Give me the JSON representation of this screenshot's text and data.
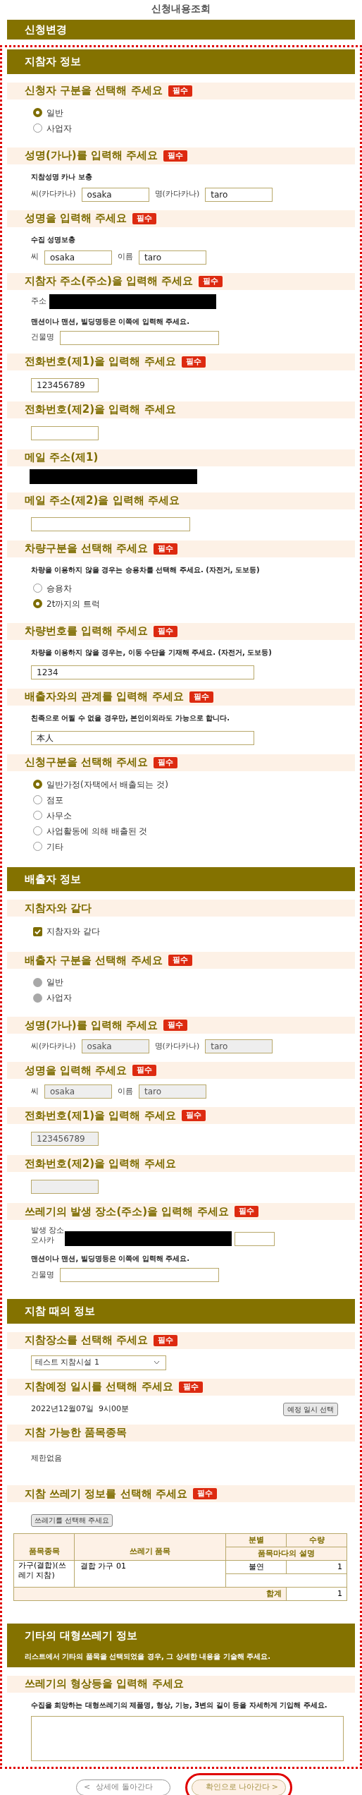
{
  "title": "신청내용조회",
  "header_bar": "신청변경",
  "sections": [
    {
      "title": "지참자 정보",
      "fields": [
        {
          "kind": "radio",
          "heading": "신청자 구분을 선택해 주세요",
          "badge": "필수",
          "disabled": false,
          "options": [
            {
              "label": "일반",
              "selected": true
            },
            {
              "label": "사업자",
              "selected": false
            }
          ]
        },
        {
          "kind": "name_pair",
          "heading": "성명(가나)를 입력해 주세요",
          "badge": "필수",
          "note": "지참성명 카나 보충",
          "disabled": false,
          "inputs": [
            {
              "label": "씨(카다카나)",
              "value": "osaka"
            },
            {
              "label": "명(카다카나)",
              "value": "taro"
            }
          ]
        },
        {
          "kind": "name_pair",
          "heading": "성명을 입력해 주세요",
          "badge": "필수",
          "note": "수집 성명보충",
          "disabled": false,
          "inputs": [
            {
              "label": "씨",
              "value": "osaka"
            },
            {
              "label": "이름",
              "value": "taro"
            }
          ]
        },
        {
          "kind": "address",
          "heading": "지참자 주소(주소)을 입력해 주세요",
          "badge": "필수",
          "label": "주소",
          "redacted": true,
          "note": "맨션이나 맨션, 빌딩명등은 이쪽에 입력해 주세요.",
          "building_label": "건물명"
        },
        {
          "kind": "phone",
          "heading": "전화번호(제1)을 입력해 주세요",
          "badge": "필수",
          "disabled": false,
          "value": "123456789"
        },
        {
          "kind": "phone",
          "heading": "전화번호(제2)을 입력해 주세요",
          "disabled": false
        },
        {
          "kind": "redacted",
          "heading": "메일 주소(제1)",
          "redacted": true
        },
        {
          "kind": "email",
          "heading": "메일 주소(제2)을 입력해 주세요",
          "disabled": false
        },
        {
          "kind": "radio",
          "heading": "차량구분을 선택해 주세요",
          "badge": "필수",
          "note": "차량을 이용하지 않을 경우는 승용차를 선택해 주세요. (자전거, 도보등)",
          "disabled": false,
          "options": [
            {
              "label": "승용차",
              "selected": false
            },
            {
              "label": "2t까지의 트럭",
              "selected": true
            }
          ]
        },
        {
          "kind": "text",
          "heading": "차량번호를 입력해 주세요",
          "badge": "필수",
          "note": "차량을 이용하지 않을 경우는, 이동 수단을 기재해 주세요. (자전거, 도보등)",
          "disabled": false,
          "value": "1234"
        },
        {
          "kind": "text",
          "heading": "배출자와의 관계를 입력해 주세요",
          "badge": "필수",
          "note": "친족으로 어찔 수 없을 경우만, 본인이외라도 가능으로 합니다.",
          "disabled": false,
          "value": "本人"
        },
        {
          "kind": "radio",
          "heading": "신청구분을 선택해 주세요",
          "badge": "필수",
          "disabled": false,
          "options": [
            {
              "label": "일반가정(자택에서 배출되는 것)",
              "selected": true
            },
            {
              "label": "점포",
              "selected": false
            },
            {
              "label": "사무소",
              "selected": false
            },
            {
              "label": "사업활동에 의해 배출된 것",
              "selected": false
            },
            {
              "label": "기타",
              "selected": false
            }
          ]
        }
      ]
    },
    {
      "title": "배출자 정보",
      "fields": [
        {
          "kind": "checkbox",
          "heading": "지참자와 같다",
          "options": [
            {
              "label": "지참자와 같다",
              "checked": true
            }
          ]
        },
        {
          "kind": "radio",
          "heading": "배출자 구분을 선택해 주세요",
          "badge": "필수",
          "disabled": true,
          "options": [
            {
              "label": "일반",
              "selected": false
            },
            {
              "label": "사업자",
              "selected": false
            }
          ]
        },
        {
          "kind": "name_pair",
          "heading": "성명(가나)를 입력해 주세요",
          "badge": "필수",
          "disabled": true,
          "inputs": [
            {
              "label": "씨(카다카나)",
              "value": "osaka"
            },
            {
              "label": "명(카다카나)",
              "value": "taro"
            }
          ]
        },
        {
          "kind": "name_pair",
          "heading": "성명을 입력해 주세요",
          "badge": "필수",
          "disabled": true,
          "inputs": [
            {
              "label": "씨",
              "value": "osaka"
            },
            {
              "label": "이름",
              "value": "taro"
            }
          ]
        },
        {
          "kind": "phone",
          "heading": "전화번호(제1)을 입력해 주세요",
          "badge": "필수",
          "disabled": true,
          "value": "123456789"
        },
        {
          "kind": "phone",
          "heading": "전화번호(제2)을 입력해 주세요",
          "disabled": true
        },
        {
          "kind": "location",
          "heading": "쓰레기의 발생 장소(주소)을 입력해 주세요",
          "badge": "필수",
          "label": "발생 장소",
          "prefix": "오사카",
          "redacted": true,
          "note": "맨션이나 맨션, 빌딩명등은 이쪽에 입력해 주세요.",
          "building_label": "건물명"
        }
      ]
    },
    {
      "title": "지참 때의 정보",
      "fields": [
        {
          "kind": "select",
          "heading": "지참장소를 선택해 주세요",
          "badge": "필수",
          "value": "테스트 지참시설 1"
        },
        {
          "kind": "datetime",
          "heading": "지참예정 일시를 선택해 주세요",
          "badge": "필수",
          "value": "2022년12월07일  9시00분",
          "button": "예정 일시 선택"
        },
        {
          "kind": "plain",
          "heading": "지참 가능한 품목종목",
          "value": "제한없음"
        },
        {
          "kind": "waste",
          "heading": "지참 쓰레기 정보를 선택해 주세요",
          "badge": "필수",
          "button": "쓰레기를 선택해 주세요",
          "table": {
            "columns": [
              "품목종목",
              "쓰레기 품목",
              "분별",
              "수량",
              "품목마다의 설명"
            ],
            "rows": [
              {
                "category": "가구(결합)(쓰레기 지참)",
                "item": "결합 가구 01",
                "sorting": "불연",
                "quantity": "1"
              }
            ],
            "total_label": "합계",
            "total": "1"
          }
        }
      ]
    },
    {
      "title": "기타의 대형쓰레기 정보",
      "note": "리스트에서 기타의 품목을 선택되었을 경우, 그 상세한 내용을 기술해 주세요.",
      "fields": [
        {
          "kind": "textarea",
          "heading": "쓰레기의 형상등을 입력해 주세요",
          "note": "수집을 희망하는 대형쓰레기의 제품명, 형상, 기능, 3변의 길이 등을 자세하게 기입해 주세요."
        }
      ]
    }
  ],
  "buttons": [
    {
      "kind": "back",
      "label": "상세에 돌아간다",
      "arrow": "<",
      "highlighted": false
    },
    {
      "kind": "next",
      "label": "확인으로 나아간다",
      "arrow": ">",
      "highlighted": true
    }
  ]
}
